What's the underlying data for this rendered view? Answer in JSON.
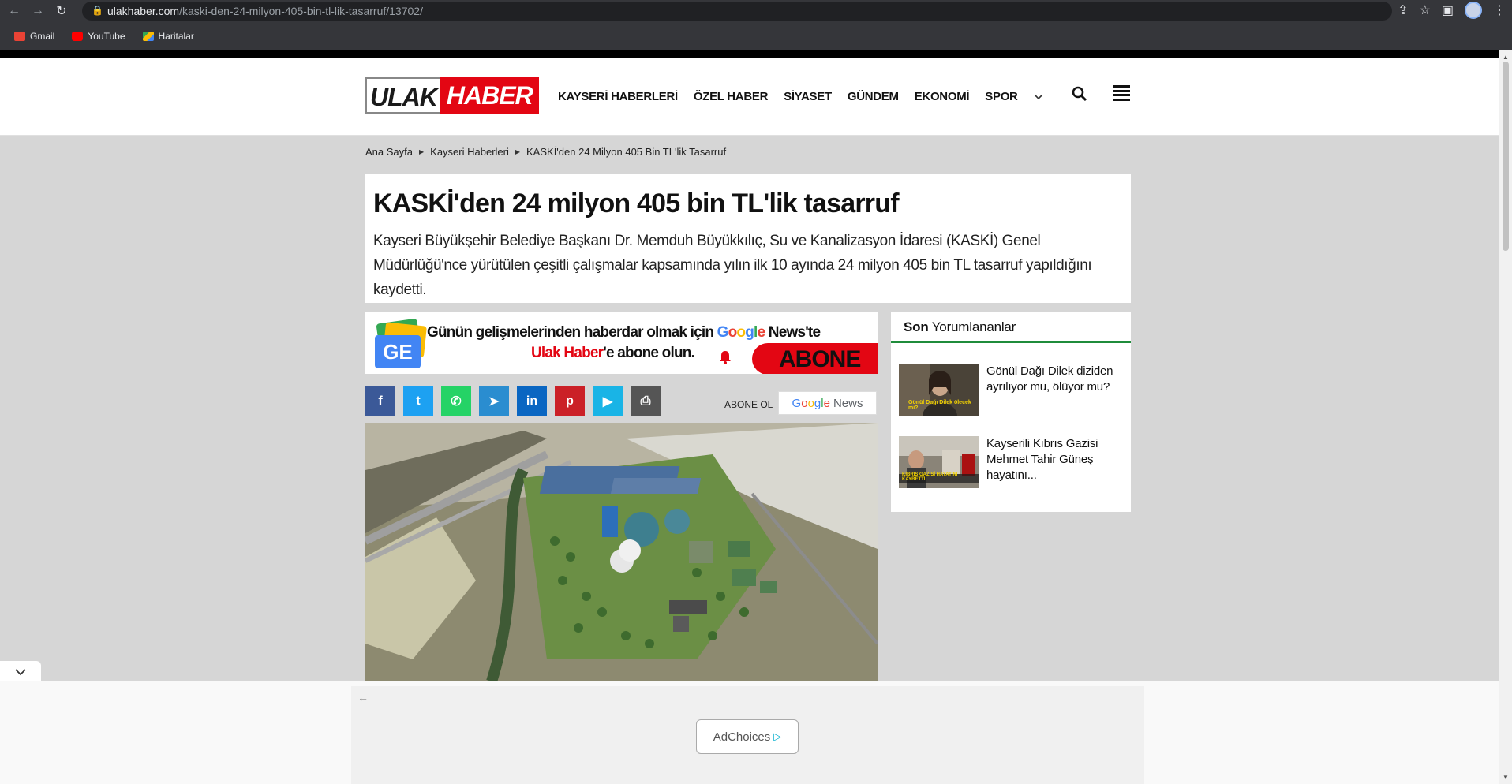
{
  "browser": {
    "url_domain": "ulakhaber.com",
    "url_path": "/kaski-den-24-milyon-405-bin-tl-lik-tasarruf/13702/",
    "bookmarks": [
      "Gmail",
      "YouTube",
      "Haritalar"
    ]
  },
  "site": {
    "logo_left": "ULAK",
    "logo_right": "HABER",
    "nav": [
      "KAYSERİ HABERLERİ",
      "ÖZEL HABER",
      "SİYASET",
      "GÜNDEM",
      "EKONOMİ",
      "SPOR"
    ]
  },
  "breadcrumb": [
    "Ana Sayfa",
    "Kayseri Haberleri",
    "KASKİ'den 24 Milyon 405 Bin TL'lik Tasarruf"
  ],
  "article": {
    "title": "KASKİ'den 24 milyon 405 bin TL'lik tasarruf",
    "lead": "Kayseri Büyükşehir Belediye Başkanı Dr. Memduh Büyükkılıç, Su ve Kanalizasyon İdaresi (KASKİ) Genel Müdürlüğü'nce yürütülen çeşitli çalışmalar kapsamında yılın ilk 10 ayında 24 milyon 405 bin TL tasarruf yapıldığını kaydetti."
  },
  "google_news_banner": {
    "line1_prefix": "Günün gelişmelerinden haberdar olmak için ",
    "google": "Google",
    "line1_suffix": " News'te",
    "line2_brand": "Ulak Haber",
    "line2_suffix": "'e abone olun.",
    "cta": "ABONE OL",
    "logo_letters": "GE"
  },
  "share": {
    "buttons": [
      {
        "name": "facebook",
        "glyph": "f",
        "color": "#3b5998"
      },
      {
        "name": "twitter",
        "glyph": "t",
        "color": "#1da1f2"
      },
      {
        "name": "whatsapp",
        "glyph": "✆",
        "color": "#25d366"
      },
      {
        "name": "telegram",
        "glyph": "➤",
        "color": "#2a8dd0"
      },
      {
        "name": "linkedin",
        "glyph": "in",
        "color": "#0a66c2"
      },
      {
        "name": "pinterest",
        "glyph": "p",
        "color": "#cb2027"
      },
      {
        "name": "google-play",
        "glyph": "▶",
        "color": "#19b4e6"
      },
      {
        "name": "print",
        "glyph": "⎙",
        "color": "#555555"
      }
    ],
    "abone_label": "ABONE OL",
    "gn_button_google": "Google",
    "gn_button_news": "News"
  },
  "sidebar": {
    "title_bold": "Son",
    "title_rest": " Yorumlananlar",
    "items": [
      {
        "text": "Gönül Dağı Dilek diziden ayrılıyor mu, ölüyor mu?",
        "thumb_caption": "Gönül Dağı Dilek ölecek mi?"
      },
      {
        "text": "Kayserili Kıbrıs Gazisi Mehmet Tahir Güneş hayatını...",
        "thumb_caption": "KIBRIS GAZİSİ HAYATINI KAYBETTİ"
      }
    ]
  },
  "ad": {
    "adchoices": "AdChoices"
  }
}
